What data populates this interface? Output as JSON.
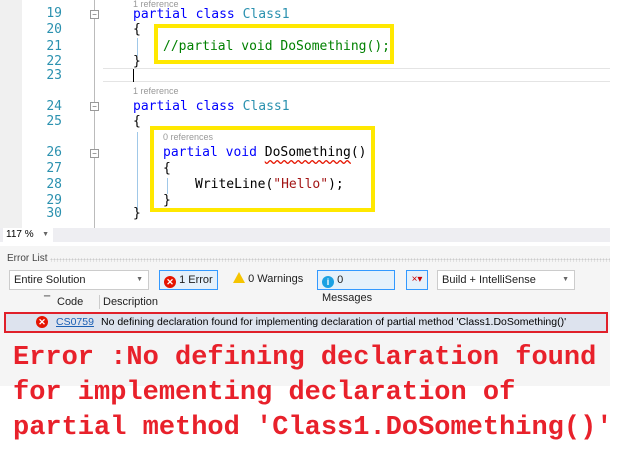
{
  "editor": {
    "lens_top": "1 reference",
    "lens_mid": "1 reference",
    "lens_inner": "0 references",
    "lines": {
      "l19": "19",
      "l20": "20",
      "l21": "21",
      "l22": "22",
      "l23": "23",
      "l24": "24",
      "l25": "25",
      "l26": "26",
      "l27": "27",
      "l28": "28",
      "l29": "29",
      "l30": "30"
    },
    "kw_partial": "partial",
    "kw_class": "class",
    "type_class1": "Class1",
    "open_brace": "{",
    "close_brace": "}",
    "comment_line": "//partial void DoSomething();",
    "kw_void": "void",
    "method_name": "DoSomething",
    "parens": "()",
    "writeline": "WriteLine(",
    "hello_string": "\"Hello\"",
    "writeline_end": ");"
  },
  "zoom": {
    "level": "117 %"
  },
  "error_list": {
    "title": "Error List",
    "scope": "Entire Solution",
    "errors_label": "1 Error",
    "warnings_label": "0 Warnings",
    "messages_label": "0 Messages",
    "build_filter": "Build + IntelliSense",
    "col_code": "Code",
    "col_description": "Description",
    "rows": [
      {
        "code": "CS0759",
        "description": "No defining declaration found for implementing declaration of partial method 'Class1.DoSomething()'"
      }
    ]
  },
  "caption": {
    "line1": "Error :No defining declaration found",
    "line2": "for implementing declaration of",
    "line3": "partial method 'Class1.DoSomething()'"
  },
  "colors": {
    "highlight": "#ffe800",
    "error_red": "#e8212b"
  }
}
